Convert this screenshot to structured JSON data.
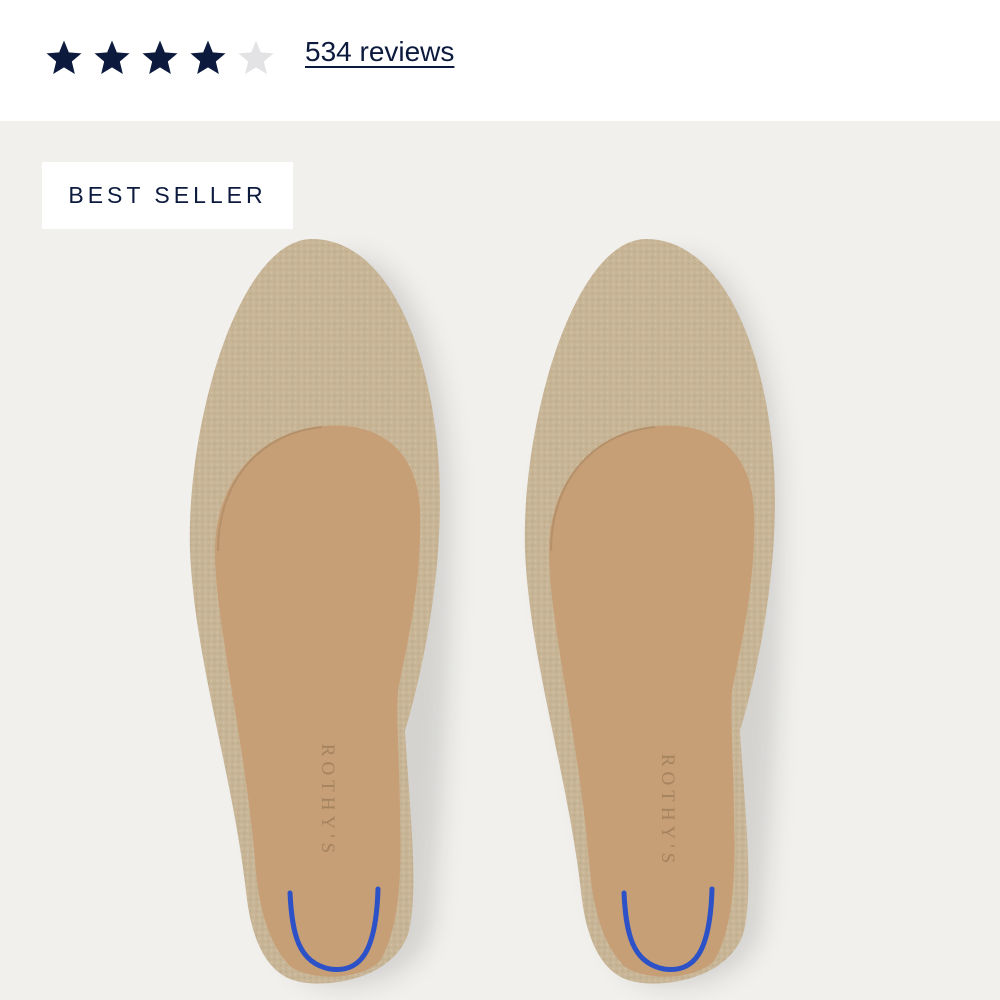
{
  "rating": {
    "value": 4,
    "max": 5,
    "reviews_label": "534 reviews",
    "filled_color": "#0c1a3d",
    "empty_color": "#e3e3e6",
    "star_icon": "star-icon"
  },
  "product": {
    "badge": "BEST SELLER",
    "brand_imprint": "ROTHY'S",
    "colors": {
      "background": "#f1f0ed",
      "knit": "#c8b596",
      "insole": "#c79f76",
      "heel_tab": "#2d52c7"
    }
  }
}
